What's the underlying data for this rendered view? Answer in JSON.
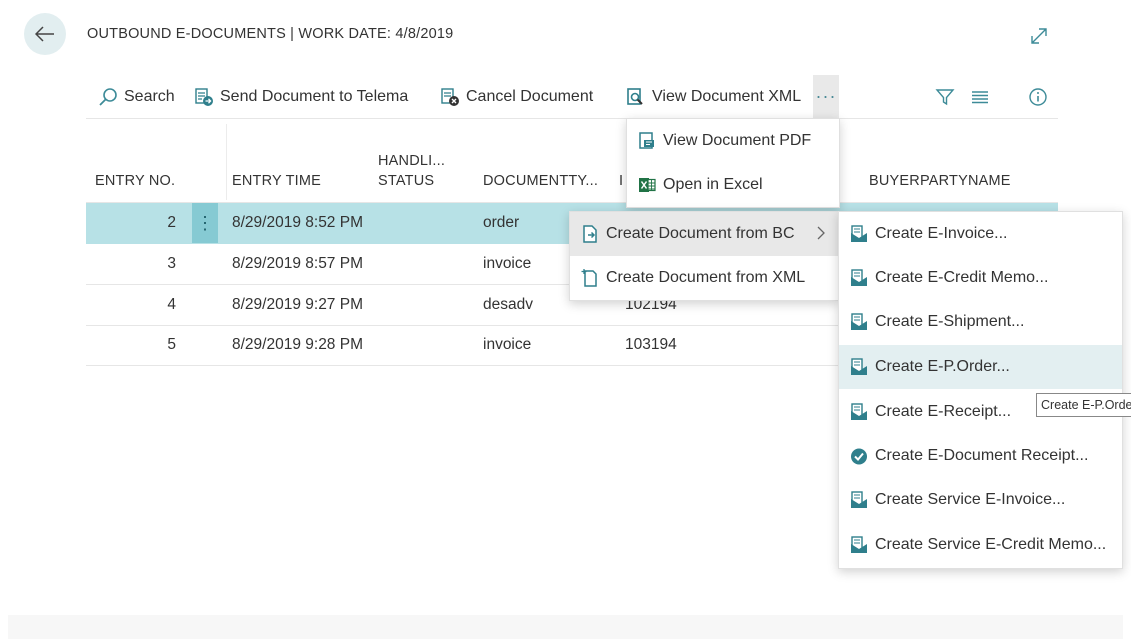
{
  "header": {
    "title": "OUTBOUND E-DOCUMENTS | WORK DATE: 4/8/2019"
  },
  "toolbar": {
    "search": "Search",
    "send": "Send Document to Telema",
    "cancel": "Cancel Document",
    "view_xml": "View Document XML",
    "more": "···"
  },
  "columns": {
    "entry_no": "ENTRY NO.",
    "entry_time": "ENTRY TIME",
    "handling_line1": "HANDLI...",
    "handling_line2": "STATUS",
    "document_type": "DOCUMENTTY...",
    "doc_no_partial": "I",
    "buyer": "BUYERPARTYNAME"
  },
  "rows": [
    {
      "entry_no": "2",
      "entry_time": "8/29/2019 8:52 PM",
      "doc_type": "order",
      "doc_no": "",
      "selected": true
    },
    {
      "entry_no": "3",
      "entry_time": "8/29/2019 8:57 PM",
      "doc_type": "invoice",
      "doc_no": ""
    },
    {
      "entry_no": "4",
      "entry_time": "8/29/2019 9:27 PM",
      "doc_type": "desadv",
      "doc_no": "102194"
    },
    {
      "entry_no": "5",
      "entry_time": "8/29/2019 9:28 PM",
      "doc_type": "invoice",
      "doc_no": "103194"
    }
  ],
  "more_menu": {
    "items": [
      "View Document PDF",
      "Open in Excel"
    ]
  },
  "create_menu": {
    "items": [
      "Create Document from BC",
      "Create Document from XML"
    ]
  },
  "submenu": {
    "items": [
      "Create E-Invoice...",
      "Create E-Credit Memo...",
      "Create E-Shipment...",
      "Create E-P.Order...",
      "Create E-Receipt...",
      "Create E-Document Receipt...",
      "Create Service E-Invoice...",
      "Create Service E-Credit Memo..."
    ]
  },
  "tooltip": "Create E-P.Order...",
  "colors": {
    "accent": "#3d8b98",
    "selected_row": "#b7e1e6",
    "excel_green": "#217346"
  }
}
